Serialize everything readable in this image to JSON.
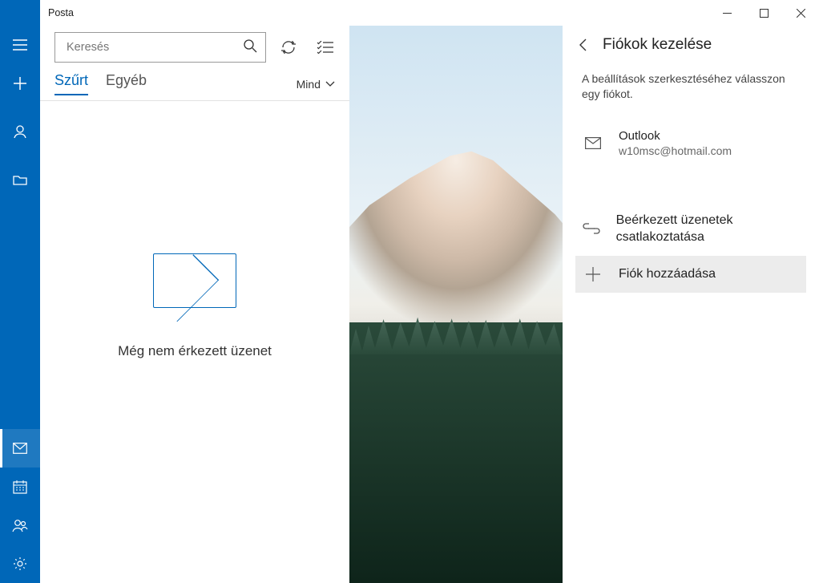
{
  "title_bar": {
    "app_name": "Posta"
  },
  "sidebar": {
    "items": [
      "menu",
      "compose",
      "account",
      "folders"
    ],
    "footer": [
      "mail",
      "calendar",
      "people",
      "settings"
    ]
  },
  "search": {
    "placeholder": "Keresés"
  },
  "tabs": {
    "focused": "Szűrt",
    "other": "Egyéb"
  },
  "filter": {
    "label": "Mind"
  },
  "empty": {
    "message": "Még nem érkezett üzenet"
  },
  "panel": {
    "title": "Fiókok kezelése",
    "subtitle": "A beállítások szerkesztéséhez válasszon egy fiókot.",
    "account": {
      "name": "Outlook",
      "email": "w10msc@hotmail.com"
    },
    "link_inbox": "Beérkezett üzenetek csatlakoztatása",
    "add_account": "Fiók hozzáadása"
  }
}
